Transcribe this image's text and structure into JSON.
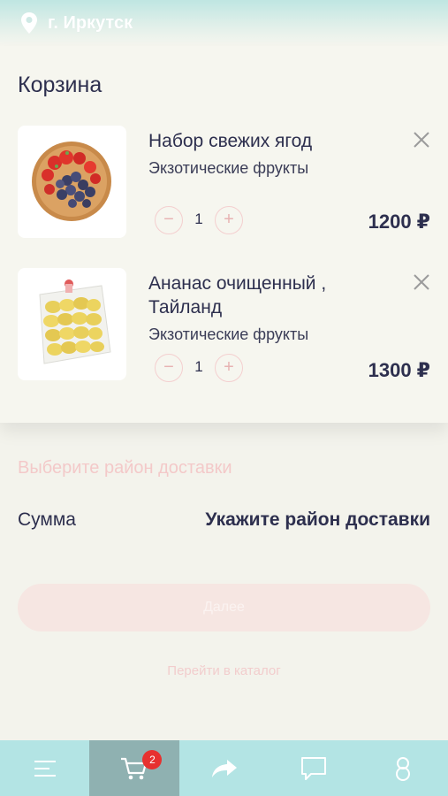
{
  "header": {
    "city": "г. Иркутск",
    "location_icon": "location-pin-icon"
  },
  "cart": {
    "title": "Корзина",
    "items": [
      {
        "name": "Набор свежих ягод",
        "category": "Экзотические фрукты",
        "quantity": "1",
        "price": "1200 ₽",
        "minus": "−",
        "plus": "+"
      },
      {
        "name": "Ананас очищенный , Тайланд",
        "category": "Экзотические фрукты",
        "quantity": "1",
        "price": "1300 ₽",
        "minus": "−",
        "plus": "+"
      }
    ]
  },
  "delivery": {
    "district_placeholder": "Выберите район доставки",
    "sum_label": "Сумма",
    "sum_value": "Укажите район доставки",
    "next_label": "Далее",
    "catalog_link": "Перейти в каталог"
  },
  "bottom_nav": {
    "items": [
      {
        "icon": "menu-icon"
      },
      {
        "icon": "cart-icon",
        "badge": "2",
        "active": true
      },
      {
        "icon": "share-icon"
      },
      {
        "icon": "chat-icon"
      },
      {
        "icon": "profile-icon"
      }
    ]
  },
  "colors": {
    "accent_nav": "#b3e4e4",
    "active_nav": "#8fb1b1",
    "badge": "#e7312f",
    "text_dark": "#2d2f4e",
    "pink_muted": "#f3c9c9"
  }
}
